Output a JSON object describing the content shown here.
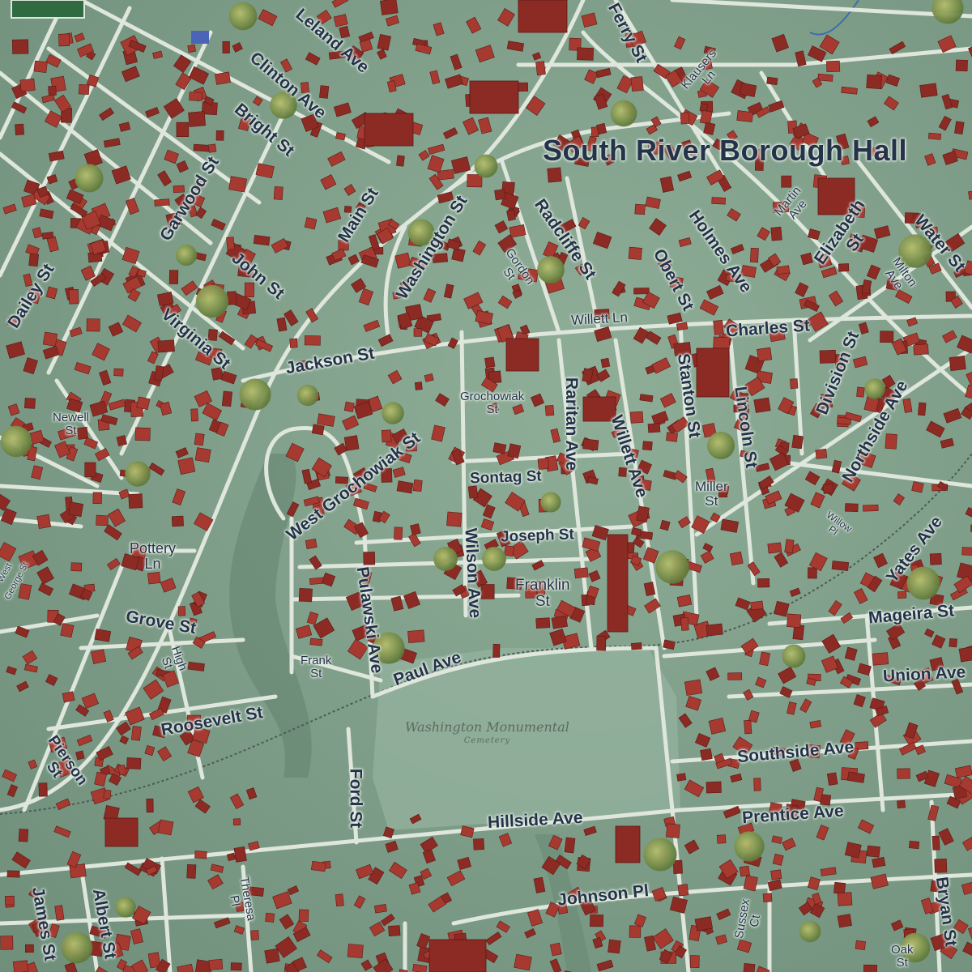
{
  "map": {
    "poi": {
      "borough_hall": "South River Borough Hall",
      "cemetery": "Washington Monumental",
      "cemetery_sub": "Cemetery"
    },
    "streets": {
      "leland_ave": "Leland Ave",
      "clinton_ave": "Clinton Ave",
      "bright_st": "Bright St",
      "garwood_st": "Garwood St",
      "dailey_st": "Dailey St",
      "john_st": "John St",
      "virginia_st": "Virginia St",
      "main_st": "Main St",
      "washington_st": "Washington St",
      "radcliffe_st": "Radcliffe St",
      "gordon_st": "Gordon\nSt",
      "ferry_st": "Ferry St",
      "klausers_ln": "Klausers\nLn",
      "obert_st": "Obert St",
      "holmes_ave": "Holmes Ave",
      "martin_ave": "Martin\nAve",
      "elizabeth_st": "Elizabeth\nSt",
      "milton_ave": "Milton\nAve",
      "water_st": "Water St",
      "willett_ln": "Willett Ln",
      "charles_st": "Charles St",
      "jackson_st": "Jackson St",
      "newell_st": "Newell\nSt",
      "grochowiak_st": "Grochowiak\nSt",
      "west_grochowiak_st": "West Grochowiak St",
      "raritan_ave": "Raritan Ave",
      "willett_ave": "Willett Ave",
      "stanton_st": "Stanton St",
      "lincoln_st": "Lincoln St",
      "division_st": "Division St",
      "northside_ave": "Northside Ave",
      "sontag_st": "Sontag St",
      "miller_st": "Miller\nSt",
      "willow_pl": "Willow\nPl",
      "joseph_st": "Joseph St",
      "franklin_st": "Franklin\nSt",
      "yates_ave": "Yates Ave",
      "pottery_ln": "Pottery\nLn",
      "west": "West",
      "george_st": "George St",
      "grove_st": "Grove St",
      "high_st": "High\nSt",
      "pulawski_ave": "Pulawski Ave",
      "wilson_ave": "Wilson Ave",
      "mageira_st": "Mageira St",
      "frank_st": "Frank\nSt",
      "paul_ave": "Paul Ave",
      "union_ave": "Union Ave",
      "roosevelt_st": "Roosevelt St",
      "pierson_st": "Pierson\nSt",
      "ford_st": "Ford St",
      "southside_ave": "Southside Ave",
      "hillside_ave": "Hillside Ave",
      "prentice_ave": "Prentice Ave",
      "james_st": "James St",
      "albert_st": "Albert St",
      "theresa_pl": "Theresa\nPl",
      "johnson_pl": "Johnson Pl",
      "sussex_ct": "Sussex\nCt",
      "bryan_st": "Bryan St",
      "oak_st": "Oak\nSt"
    },
    "colors": {
      "land": "#7f9e8a",
      "road": "#dfe6dc",
      "building": "#8c2a24",
      "building_roof": "#a63a30",
      "tree": "#8a9a52",
      "cemetery": "#96b39f",
      "label": "#24324a"
    }
  }
}
